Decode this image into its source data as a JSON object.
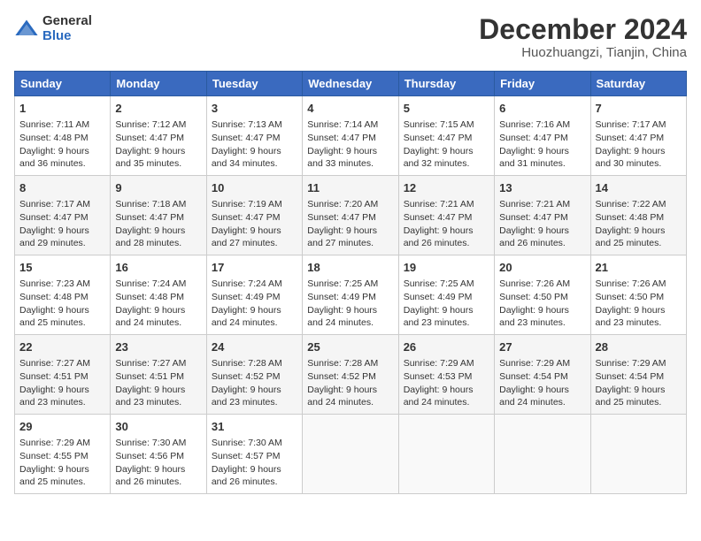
{
  "header": {
    "logo_general": "General",
    "logo_blue": "Blue",
    "month": "December 2024",
    "location": "Huozhuangzi, Tianjin, China"
  },
  "weekdays": [
    "Sunday",
    "Monday",
    "Tuesday",
    "Wednesday",
    "Thursday",
    "Friday",
    "Saturday"
  ],
  "weeks": [
    [
      {
        "day": "1",
        "sunrise": "Sunrise: 7:11 AM",
        "sunset": "Sunset: 4:48 PM",
        "daylight": "Daylight: 9 hours and 36 minutes."
      },
      {
        "day": "2",
        "sunrise": "Sunrise: 7:12 AM",
        "sunset": "Sunset: 4:47 PM",
        "daylight": "Daylight: 9 hours and 35 minutes."
      },
      {
        "day": "3",
        "sunrise": "Sunrise: 7:13 AM",
        "sunset": "Sunset: 4:47 PM",
        "daylight": "Daylight: 9 hours and 34 minutes."
      },
      {
        "day": "4",
        "sunrise": "Sunrise: 7:14 AM",
        "sunset": "Sunset: 4:47 PM",
        "daylight": "Daylight: 9 hours and 33 minutes."
      },
      {
        "day": "5",
        "sunrise": "Sunrise: 7:15 AM",
        "sunset": "Sunset: 4:47 PM",
        "daylight": "Daylight: 9 hours and 32 minutes."
      },
      {
        "day": "6",
        "sunrise": "Sunrise: 7:16 AM",
        "sunset": "Sunset: 4:47 PM",
        "daylight": "Daylight: 9 hours and 31 minutes."
      },
      {
        "day": "7",
        "sunrise": "Sunrise: 7:17 AM",
        "sunset": "Sunset: 4:47 PM",
        "daylight": "Daylight: 9 hours and 30 minutes."
      }
    ],
    [
      {
        "day": "8",
        "sunrise": "Sunrise: 7:17 AM",
        "sunset": "Sunset: 4:47 PM",
        "daylight": "Daylight: 9 hours and 29 minutes."
      },
      {
        "day": "9",
        "sunrise": "Sunrise: 7:18 AM",
        "sunset": "Sunset: 4:47 PM",
        "daylight": "Daylight: 9 hours and 28 minutes."
      },
      {
        "day": "10",
        "sunrise": "Sunrise: 7:19 AM",
        "sunset": "Sunset: 4:47 PM",
        "daylight": "Daylight: 9 hours and 27 minutes."
      },
      {
        "day": "11",
        "sunrise": "Sunrise: 7:20 AM",
        "sunset": "Sunset: 4:47 PM",
        "daylight": "Daylight: 9 hours and 27 minutes."
      },
      {
        "day": "12",
        "sunrise": "Sunrise: 7:21 AM",
        "sunset": "Sunset: 4:47 PM",
        "daylight": "Daylight: 9 hours and 26 minutes."
      },
      {
        "day": "13",
        "sunrise": "Sunrise: 7:21 AM",
        "sunset": "Sunset: 4:47 PM",
        "daylight": "Daylight: 9 hours and 26 minutes."
      },
      {
        "day": "14",
        "sunrise": "Sunrise: 7:22 AM",
        "sunset": "Sunset: 4:48 PM",
        "daylight": "Daylight: 9 hours and 25 minutes."
      }
    ],
    [
      {
        "day": "15",
        "sunrise": "Sunrise: 7:23 AM",
        "sunset": "Sunset: 4:48 PM",
        "daylight": "Daylight: 9 hours and 25 minutes."
      },
      {
        "day": "16",
        "sunrise": "Sunrise: 7:24 AM",
        "sunset": "Sunset: 4:48 PM",
        "daylight": "Daylight: 9 hours and 24 minutes."
      },
      {
        "day": "17",
        "sunrise": "Sunrise: 7:24 AM",
        "sunset": "Sunset: 4:49 PM",
        "daylight": "Daylight: 9 hours and 24 minutes."
      },
      {
        "day": "18",
        "sunrise": "Sunrise: 7:25 AM",
        "sunset": "Sunset: 4:49 PM",
        "daylight": "Daylight: 9 hours and 24 minutes."
      },
      {
        "day": "19",
        "sunrise": "Sunrise: 7:25 AM",
        "sunset": "Sunset: 4:49 PM",
        "daylight": "Daylight: 9 hours and 23 minutes."
      },
      {
        "day": "20",
        "sunrise": "Sunrise: 7:26 AM",
        "sunset": "Sunset: 4:50 PM",
        "daylight": "Daylight: 9 hours and 23 minutes."
      },
      {
        "day": "21",
        "sunrise": "Sunrise: 7:26 AM",
        "sunset": "Sunset: 4:50 PM",
        "daylight": "Daylight: 9 hours and 23 minutes."
      }
    ],
    [
      {
        "day": "22",
        "sunrise": "Sunrise: 7:27 AM",
        "sunset": "Sunset: 4:51 PM",
        "daylight": "Daylight: 9 hours and 23 minutes."
      },
      {
        "day": "23",
        "sunrise": "Sunrise: 7:27 AM",
        "sunset": "Sunset: 4:51 PM",
        "daylight": "Daylight: 9 hours and 23 minutes."
      },
      {
        "day": "24",
        "sunrise": "Sunrise: 7:28 AM",
        "sunset": "Sunset: 4:52 PM",
        "daylight": "Daylight: 9 hours and 23 minutes."
      },
      {
        "day": "25",
        "sunrise": "Sunrise: 7:28 AM",
        "sunset": "Sunset: 4:52 PM",
        "daylight": "Daylight: 9 hours and 24 minutes."
      },
      {
        "day": "26",
        "sunrise": "Sunrise: 7:29 AM",
        "sunset": "Sunset: 4:53 PM",
        "daylight": "Daylight: 9 hours and 24 minutes."
      },
      {
        "day": "27",
        "sunrise": "Sunrise: 7:29 AM",
        "sunset": "Sunset: 4:54 PM",
        "daylight": "Daylight: 9 hours and 24 minutes."
      },
      {
        "day": "28",
        "sunrise": "Sunrise: 7:29 AM",
        "sunset": "Sunset: 4:54 PM",
        "daylight": "Daylight: 9 hours and 25 minutes."
      }
    ],
    [
      {
        "day": "29",
        "sunrise": "Sunrise: 7:29 AM",
        "sunset": "Sunset: 4:55 PM",
        "daylight": "Daylight: 9 hours and 25 minutes."
      },
      {
        "day": "30",
        "sunrise": "Sunrise: 7:30 AM",
        "sunset": "Sunset: 4:56 PM",
        "daylight": "Daylight: 9 hours and 26 minutes."
      },
      {
        "day": "31",
        "sunrise": "Sunrise: 7:30 AM",
        "sunset": "Sunset: 4:57 PM",
        "daylight": "Daylight: 9 hours and 26 minutes."
      },
      null,
      null,
      null,
      null
    ]
  ]
}
